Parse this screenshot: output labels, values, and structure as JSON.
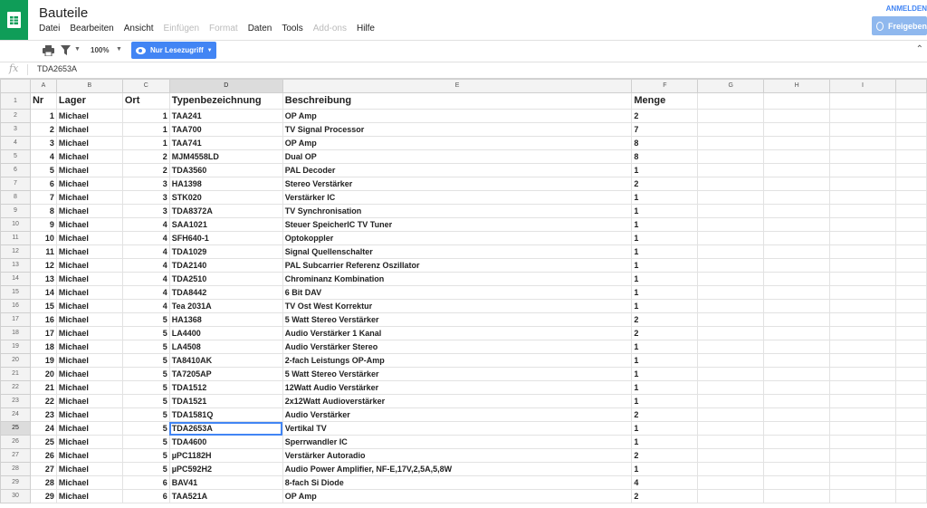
{
  "header": {
    "title": "Bauteile",
    "signin_label": "ANMELDEN",
    "share_label": "Freigeben",
    "menu": [
      {
        "label": "Datei",
        "enabled": true
      },
      {
        "label": "Bearbeiten",
        "enabled": true
      },
      {
        "label": "Ansicht",
        "enabled": true
      },
      {
        "label": "Einfügen",
        "enabled": false
      },
      {
        "label": "Format",
        "enabled": false
      },
      {
        "label": "Daten",
        "enabled": true
      },
      {
        "label": "Tools",
        "enabled": true
      },
      {
        "label": "Add-ons",
        "enabled": false
      },
      {
        "label": "Hilfe",
        "enabled": true
      }
    ]
  },
  "toolbar": {
    "zoom": "100%",
    "mode_label": "Nur Lesezugriff"
  },
  "formula_bar": {
    "fx_label": "fx",
    "value": "TDA2653A"
  },
  "grid": {
    "columns": [
      "A",
      "B",
      "C",
      "D",
      "E",
      "F",
      "G",
      "H",
      "I"
    ],
    "selected_column": "D",
    "selected_row": 25,
    "active_cell": {
      "row": 25,
      "col": "D"
    },
    "header_row": [
      "Nr",
      "Lager",
      "Ort",
      "Typenbezeichnung",
      "Beschreibung",
      "Menge"
    ],
    "rows": [
      [
        "1",
        "Michael",
        "1",
        "TAA241",
        "OP Amp",
        "2"
      ],
      [
        "2",
        "Michael",
        "1",
        "TAA700",
        "TV Signal Processor",
        "7"
      ],
      [
        "3",
        "Michael",
        "1",
        "TAA741",
        "OP Amp",
        "8"
      ],
      [
        "4",
        "Michael",
        "2",
        "MJM4558LD",
        "Dual OP",
        "8"
      ],
      [
        "5",
        "Michael",
        "2",
        "TDA3560",
        "PAL Decoder",
        "1"
      ],
      [
        "6",
        "Michael",
        "3",
        "HA1398",
        "Stereo Verstärker",
        "2"
      ],
      [
        "7",
        "Michael",
        "3",
        "STK020",
        "Verstärker IC",
        "1"
      ],
      [
        "8",
        "Michael",
        "3",
        "TDA8372A",
        "TV Synchronisation",
        "1"
      ],
      [
        "9",
        "Michael",
        "4",
        "SAA1021",
        "Steuer SpeicherIC TV Tuner",
        "1"
      ],
      [
        "10",
        "Michael",
        "4",
        "SFH640-1",
        "Optokoppler",
        "1"
      ],
      [
        "11",
        "Michael",
        "4",
        "TDA1029",
        "Signal Quellenschalter",
        "1"
      ],
      [
        "12",
        "Michael",
        "4",
        "TDA2140",
        "PAL Subcarrier Referenz Oszillator",
        "1"
      ],
      [
        "13",
        "Michael",
        "4",
        "TDA2510",
        "Chrominanz Kombination",
        "1"
      ],
      [
        "14",
        "Michael",
        "4",
        "TDA8442",
        "6 Bit DAV",
        "1"
      ],
      [
        "15",
        "Michael",
        "4",
        "Tea 2031A",
        "TV Ost West Korrektur",
        "1"
      ],
      [
        "16",
        "Michael",
        "5",
        "HA1368",
        "5 Watt Stereo Verstärker",
        "2"
      ],
      [
        "17",
        "Michael",
        "5",
        "LA4400",
        "Audio Verstärker 1 Kanal",
        "2"
      ],
      [
        "18",
        "Michael",
        "5",
        "LA4508",
        "Audio Verstärker Stereo",
        "1"
      ],
      [
        "19",
        "Michael",
        "5",
        "TA8410AK",
        "2-fach Leistungs OP-Amp",
        "1"
      ],
      [
        "20",
        "Michael",
        "5",
        "TA7205AP",
        "5 Watt Stereo Verstärker",
        "1"
      ],
      [
        "21",
        "Michael",
        "5",
        "TDA1512",
        "12Watt Audio Verstärker",
        "1"
      ],
      [
        "22",
        "Michael",
        "5",
        "TDA1521",
        "2x12Watt Audioverstärker",
        "1"
      ],
      [
        "23",
        "Michael",
        "5",
        "TDA1581Q",
        "Audio Verstärker",
        "2"
      ],
      [
        "24",
        "Michael",
        "5",
        "TDA2653A",
        "Vertikal TV",
        "1"
      ],
      [
        "25",
        "Michael",
        "5",
        "TDA4600",
        "Sperrwandler IC",
        "1"
      ],
      [
        "26",
        "Michael",
        "5",
        "µPC1182H",
        "Verstärker Autoradio",
        "2"
      ],
      [
        "27",
        "Michael",
        "5",
        "µPC592H2",
        "Audio Power Amplifier, NF-E,17V,2,5A,5,8W",
        "1"
      ],
      [
        "28",
        "Michael",
        "6",
        "BAV41",
        "8-fach Si Diode",
        "4"
      ],
      [
        "29",
        "Michael",
        "6",
        "TAA521A",
        "OP Amp",
        "2"
      ]
    ]
  }
}
